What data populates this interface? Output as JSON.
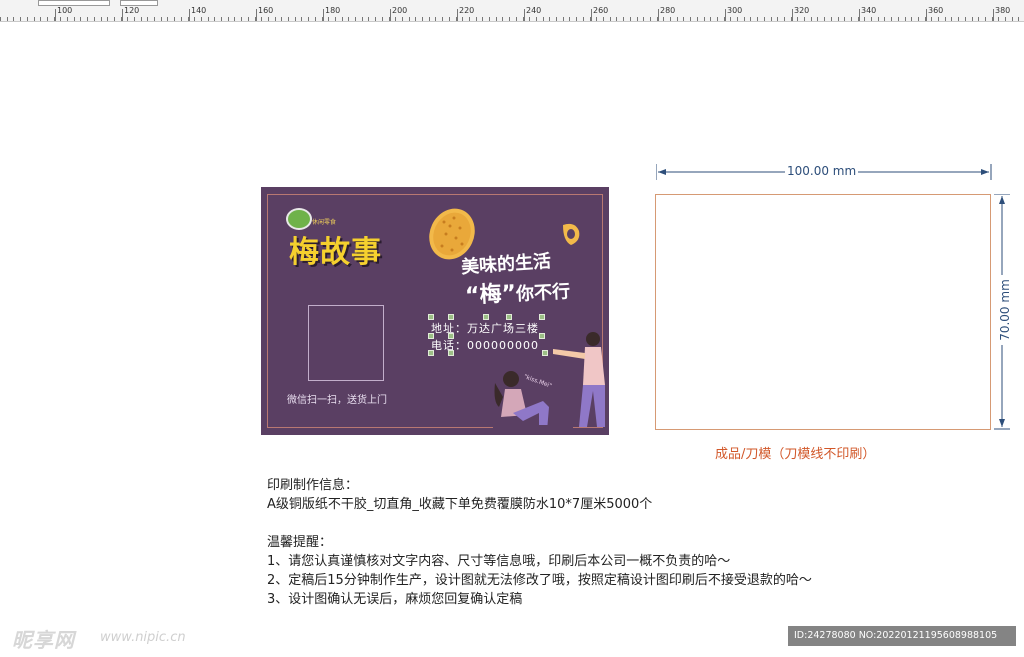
{
  "ruler": {
    "labels": [
      "100",
      "120",
      "140",
      "160",
      "180",
      "200",
      "220",
      "240",
      "260",
      "280",
      "300",
      "320",
      "340",
      "360",
      "380"
    ]
  },
  "card": {
    "logo_small": "休闲零食",
    "brand": "梅故事",
    "slogan_line1": "美味的生活",
    "slogan_quote_char": "“梅”",
    "slogan_line2_rest": "你不行",
    "wechat_text": "微信扫一扫，送货上门",
    "address": "地址：万达广场三楼",
    "phone": "电话：000000000",
    "kiss_text": "\"kiss.Mei\"",
    "colors": {
      "background": "#5a3f63",
      "brand": "#f5d02e",
      "border": "#b87872"
    }
  },
  "dieline": {
    "width_label": "100.00 mm",
    "height_label": "70.00 mm",
    "caption": "成品/刀模（刀模线不印刷）",
    "colors": {
      "line": "#d69a74",
      "caption": "#d2582a",
      "dimension": "#2d4e7a"
    }
  },
  "info": {
    "heading": "印刷制作信息：",
    "spec": "A级铜版纸不干胶_切直角_收藏下单免费覆膜防水10*7厘米5000个",
    "reminder_heading": "温馨提醒：",
    "items": [
      "1、请您认真谨慎核对文字内容、尺寸等信息哦，印刷后本公司一概不负责的哈～",
      "2、定稿后15分钟制作生产，设计图就无法修改了哦，按照定稿设计图印刷后不接受退款的哈～",
      "3、设计图确认无误后，麻烦您回复确认定稿"
    ]
  },
  "watermark": {
    "logo": "昵享网",
    "url": "www.nipic.cn",
    "id_text": "ID:24278080 NO:20220121195608988105"
  }
}
